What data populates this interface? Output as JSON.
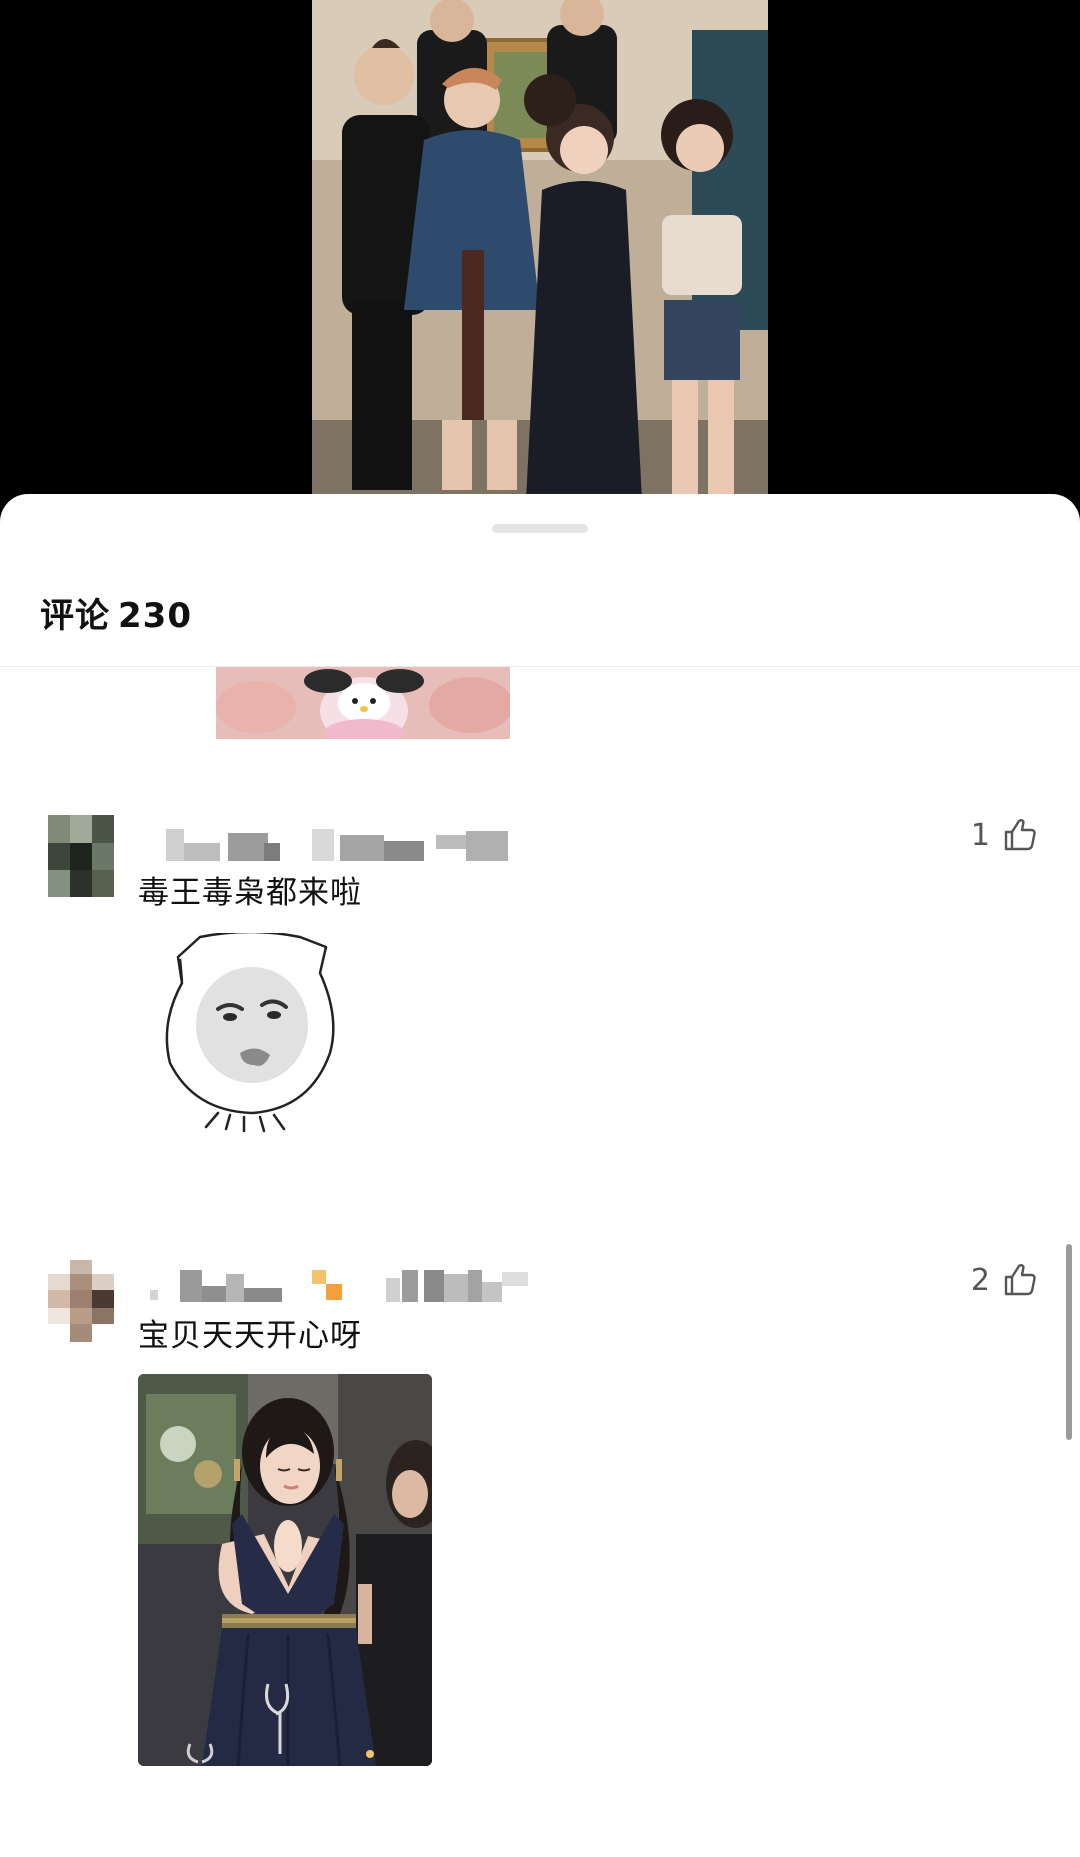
{
  "comments_sheet": {
    "title": "评论",
    "count": "230"
  },
  "comments": [
    {
      "text": "毒王毒枭都来啦",
      "likes": "1",
      "attachment": "crying-cat-sticker"
    },
    {
      "text": "宝贝天天开心呀",
      "likes": "2",
      "attachment": "photo"
    }
  ],
  "icons": {
    "like": "thumb-up-icon"
  },
  "colors": {
    "sheet_background": "#ffffff",
    "text": "#111111",
    "muted": "#555555",
    "accent_orange": "#f5a03a"
  }
}
